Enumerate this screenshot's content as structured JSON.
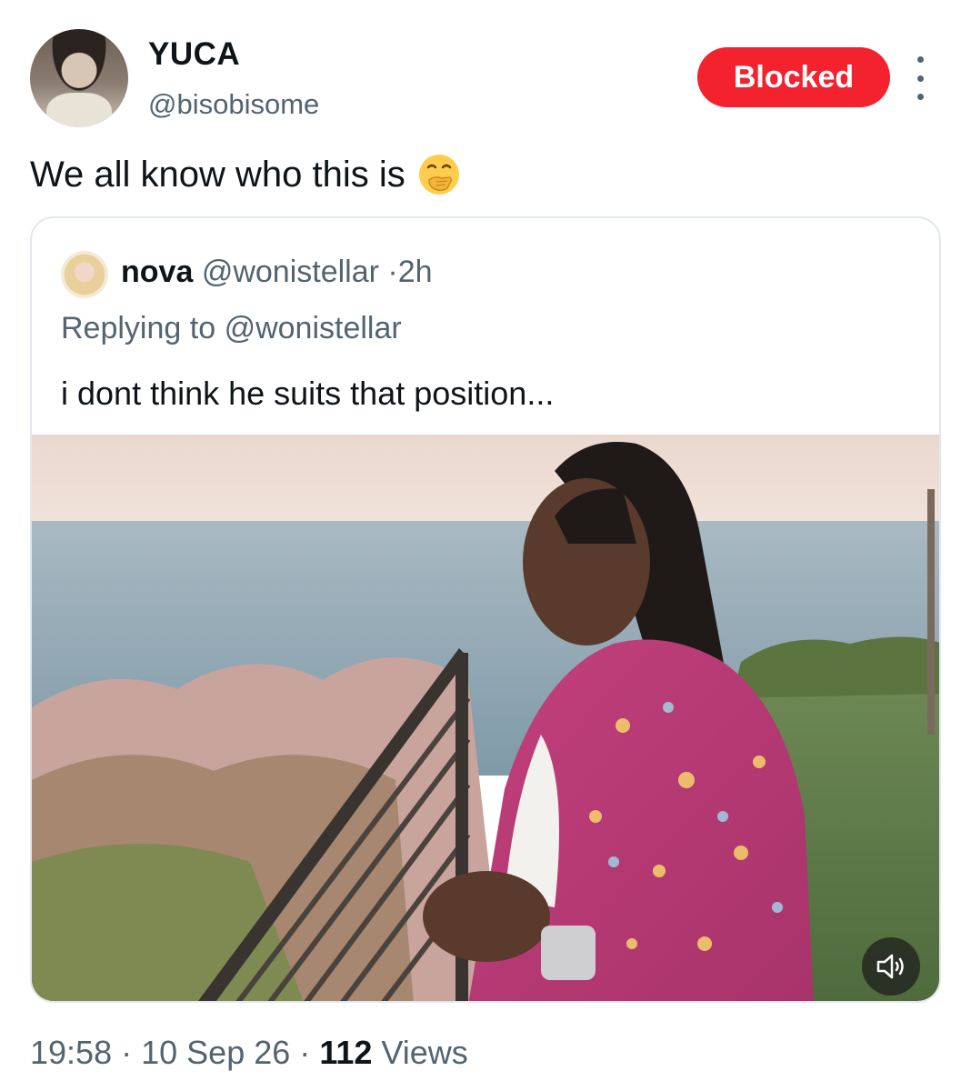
{
  "author": {
    "display_name": "YUCA",
    "handle": "@bisobisome"
  },
  "actions": {
    "blocked_label": "Blocked",
    "blocked_color": "#f4212e"
  },
  "tweet": {
    "text": "We all know who this is",
    "emoji": "face-with-hand-over-mouth-icon"
  },
  "quoted": {
    "name": "nova",
    "handle": "@wonistellar",
    "separator": "·",
    "time": "2h",
    "replying_prefix": "Replying to",
    "replying_to": "@wonistellar",
    "text": "i dont think he suits that position...",
    "media_icon": "speaker-icon"
  },
  "meta": {
    "time": "19:58",
    "dot1": "·",
    "date": "10 Sep 26",
    "dot2": "·",
    "views_count": "112",
    "views_label": "Views"
  }
}
